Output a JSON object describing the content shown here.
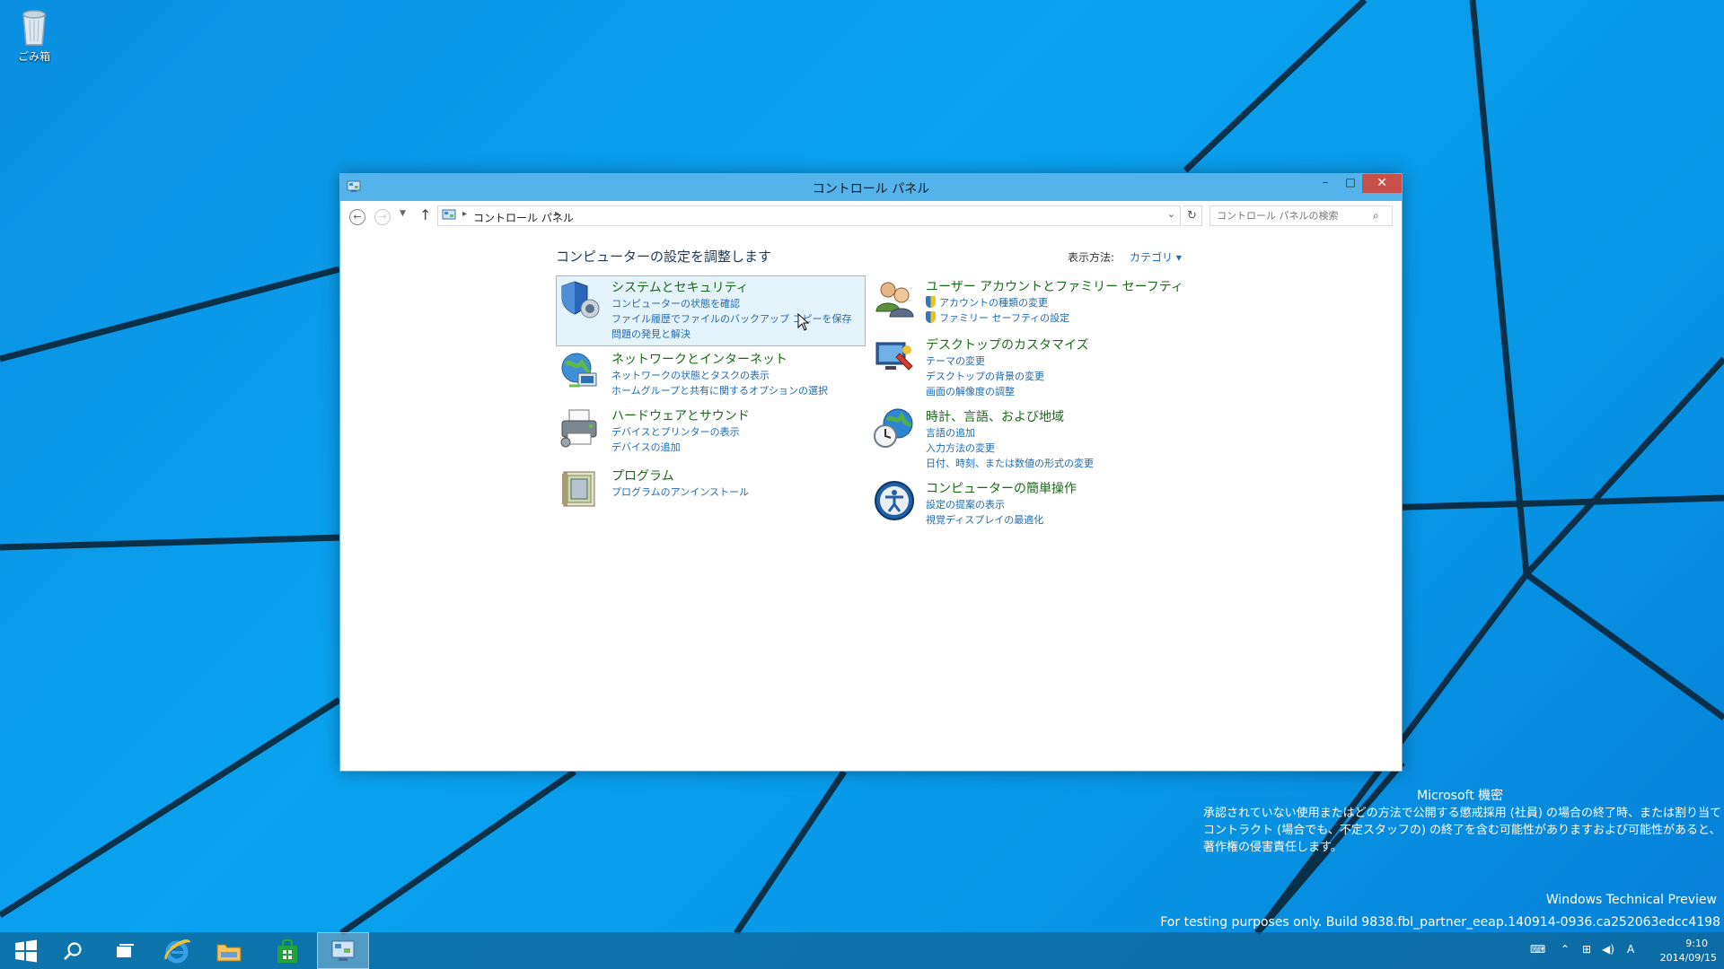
{
  "desktop": {
    "recycle_bin_label": "ごみ箱"
  },
  "window": {
    "title": "コントロール パネル",
    "minimize": "–",
    "maximize": "□",
    "close": "✕",
    "breadcrumb": "コントロール パネル",
    "search_placeholder": "コントロール パネルの検索",
    "heading": "コンピューターの設定を調整します",
    "view_by_label": "表示方法:",
    "view_by_value": "カテゴリ ▾",
    "categories": [
      {
        "title": "システムとセキュリティ",
        "icon": "shield-icon",
        "links": [
          "コンピューターの状態を確認",
          "ファイル履歴でファイルのバックアップ コピーを保存",
          "問題の発見と解決"
        ]
      },
      {
        "title": "ネットワークとインターネット",
        "icon": "network-globe-icon",
        "links": [
          "ネットワークの状態とタスクの表示",
          "ホームグループと共有に関するオプションの選択"
        ]
      },
      {
        "title": "ハードウェアとサウンド",
        "icon": "printer-icon",
        "links": [
          "デバイスとプリンターの表示",
          "デバイスの追加"
        ]
      },
      {
        "title": "プログラム",
        "icon": "programs-icon",
        "links": [
          "プログラムのアンインストール"
        ]
      },
      {
        "title": "ユーザー アカウントとファミリー セーフティ",
        "icon": "users-icon",
        "links": [
          "アカウントの種類の変更",
          "ファミリー セーフティの設定"
        ]
      },
      {
        "title": "デスクトップのカスタマイズ",
        "icon": "desktop-personalize-icon",
        "links": [
          "テーマの変更",
          "デスクトップの背景の変更",
          "画面の解像度の調整"
        ]
      },
      {
        "title": "時計、言語、および地域",
        "icon": "clock-globe-icon",
        "links": [
          "言語の追加",
          "入力方法の変更",
          "日付、時刻、または数値の形式の変更"
        ]
      },
      {
        "title": "コンピューターの簡単操作",
        "icon": "ease-of-access-icon",
        "links": [
          "設定の提案の表示",
          "視覚ディスプレイの最適化"
        ]
      }
    ]
  },
  "watermark": {
    "title": "Microsoft 機密",
    "body": "承認されていない使用またはどの方法で公開する懲戒採用 (社員) の場合の終了時、または割り当てコントラクト (場合でも、不定スタッフの) の終了を含む可能性がありますおよび可能性があると、著作権の侵害責任します。",
    "edition": "Windows Technical Preview",
    "build": "For testing purposes only. Build 9838.fbl_partner_eeap.140914-0936.ca252063edcc4198"
  },
  "taskbar": {
    "time": "9:10",
    "date": "2014/09/15",
    "ime": "A"
  }
}
